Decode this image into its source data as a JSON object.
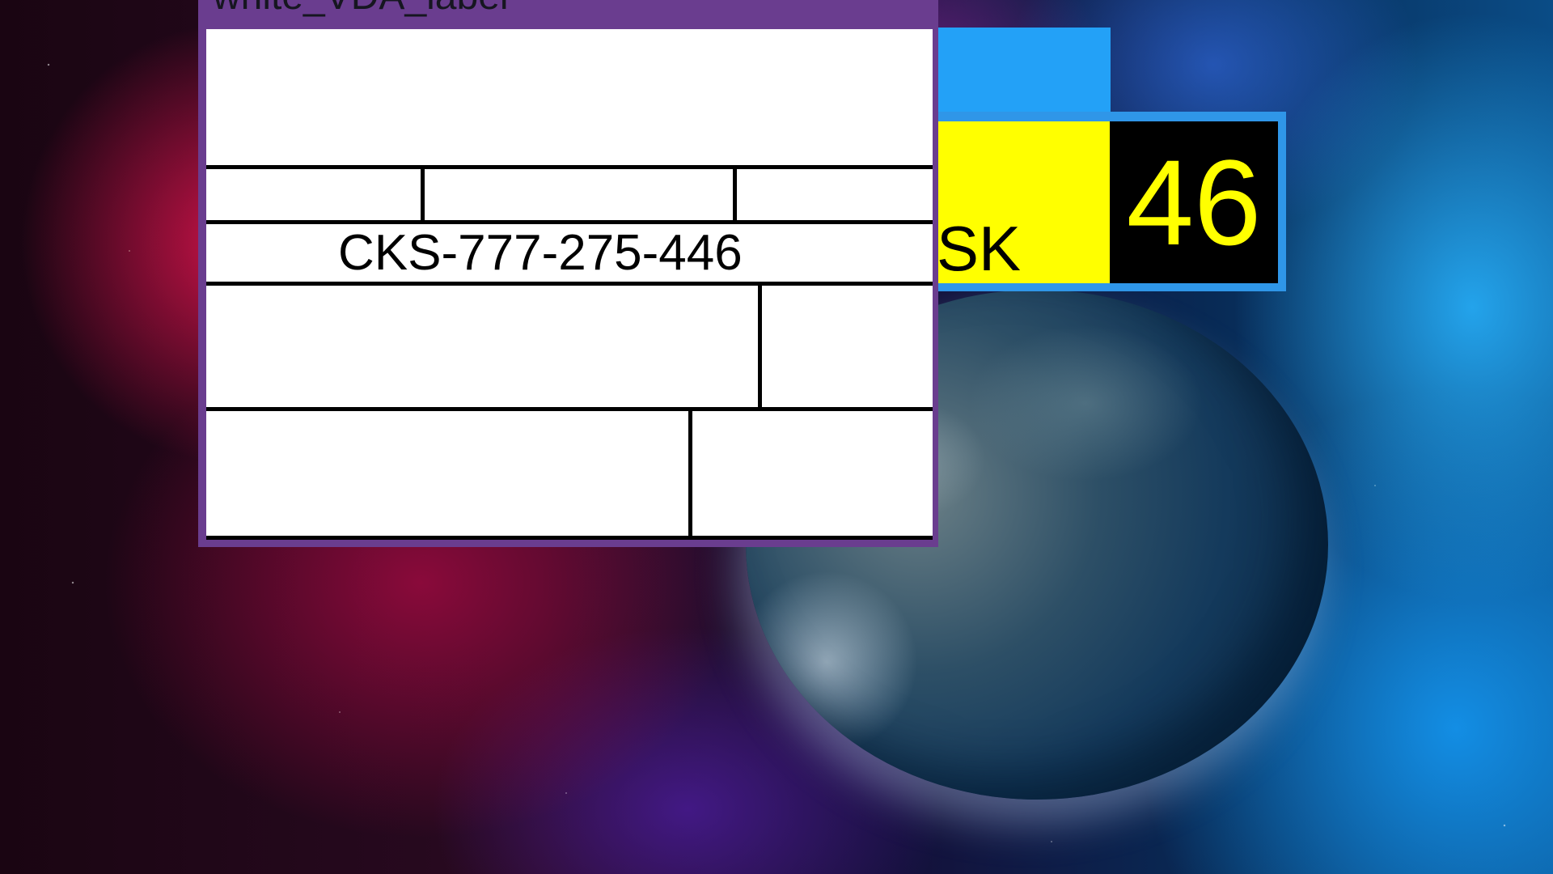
{
  "window": {
    "title": "white_VDA_label"
  },
  "label": {
    "code": "CKS-777-275-446"
  },
  "score_panel": {
    "left_text": "SK",
    "right_value": "46",
    "colors": {
      "panel_border": "#2f96e8",
      "left_bg": "#ffff00",
      "right_bg": "#000000",
      "right_text": "#ffff00"
    }
  },
  "colors": {
    "window_frame": "#6a3d8f",
    "blue_tab": "#23a1f7"
  }
}
